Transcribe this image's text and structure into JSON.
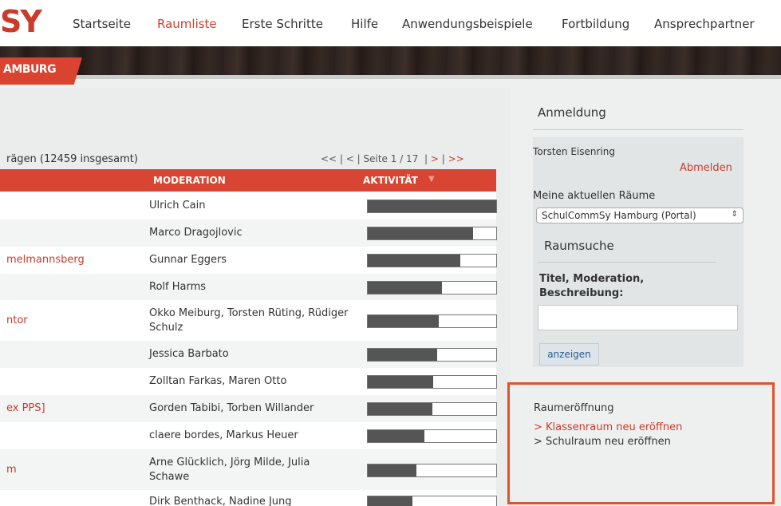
{
  "nav": {
    "logo": "SY",
    "items": [
      "Startseite",
      "Raumliste",
      "Erste Schritte",
      "Hilfe",
      "Anwendungsbeispiele",
      "Fortbildung",
      "Ansprechpartner"
    ]
  },
  "banner": {
    "badge": "AMBURG"
  },
  "list": {
    "count_text": "rägen (12459 insgesamt)",
    "pager": {
      "first": "<<",
      "prev": "<",
      "page": "Seite 1 / 17",
      "next": ">",
      "last": ">>"
    },
    "headers": {
      "moderation": "MODERATION",
      "activity": "AKTIVITÄT",
      "sort_indicator": "▼"
    },
    "rows": [
      {
        "title": "",
        "moderation": "Ulrich Cain",
        "activity": 1.0
      },
      {
        "title": "",
        "moderation": "Marco Dragojlovic",
        "activity": 0.82
      },
      {
        "title": "melmannsberg",
        "moderation": "Gunnar Eggers",
        "activity": 0.72
      },
      {
        "title": "",
        "moderation": "Rolf Harms",
        "activity": 0.58
      },
      {
        "title": "ntor",
        "moderation": "Okko Meiburg, Torsten Rüting, Rüdiger Schulz",
        "activity": 0.55
      },
      {
        "title": "",
        "moderation": "Jessica Barbato",
        "activity": 0.54
      },
      {
        "title": "",
        "moderation": "Zolltan Farkas, Maren Otto",
        "activity": 0.51
      },
      {
        "title": "ex PPS]",
        "moderation": "Gorden Tabibi, Torben Willander",
        "activity": 0.5
      },
      {
        "title": "",
        "moderation": "claere bordes, Markus Heuer",
        "activity": 0.44
      },
      {
        "title": "m",
        "moderation": "Arne Glücklich, Jörg Milde, Julia Schawe",
        "activity": 0.38
      },
      {
        "title": "",
        "moderation": "Dirk Benthack, Nadine Jung",
        "activity": 0.35
      }
    ]
  },
  "sidebar": {
    "login_head": "Anmeldung",
    "user_name": "Torsten Eisenring",
    "logout": "Abmelden",
    "rooms_label": "Meine aktuellen Räume",
    "rooms_selected": "SchulCommSy Hamburg (Portal)",
    "search_head": "Raumsuche",
    "search_label": "Titel, Moderation, Beschreibung:",
    "search_button": "anzeigen",
    "open_head": "Raumeröffnung",
    "open_class": "> Klassenraum neu eröffnen",
    "open_school": "> Schulraum neu eröffnen"
  },
  "colors": {
    "accent": "#cc3a2b",
    "header_red": "#d84532",
    "highlight": "#e0522f"
  }
}
